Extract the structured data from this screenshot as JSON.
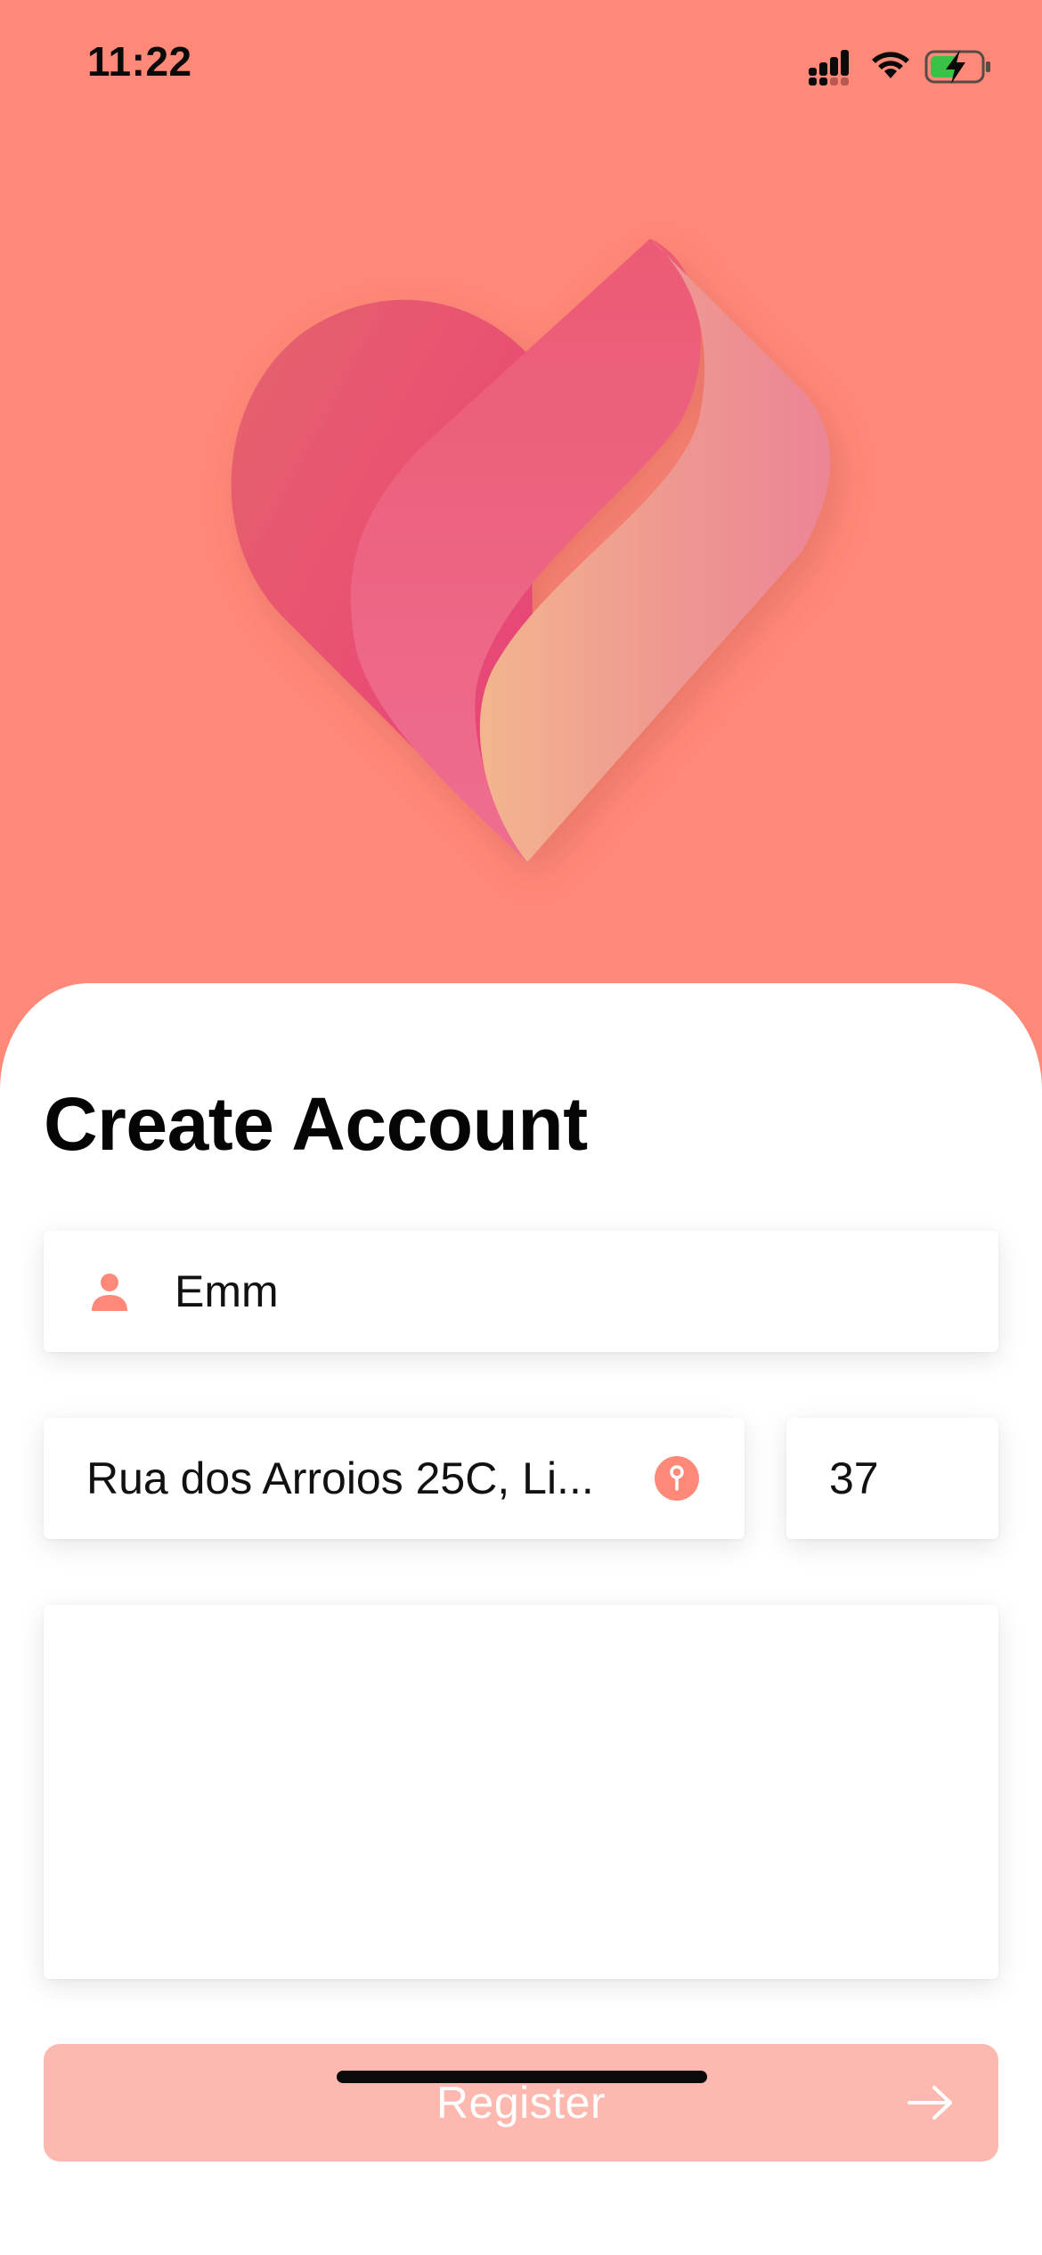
{
  "status_bar": {
    "time": "11:22",
    "icons": [
      "cellular-signal-icon",
      "wifi-icon",
      "battery-charging-icon"
    ]
  },
  "hero": {
    "icon": "heart-logo-icon"
  },
  "form": {
    "title": "Create Account",
    "name_field": {
      "icon": "person-icon",
      "value": "Emm"
    },
    "address_field": {
      "value": "Rua dos Arroios 25C, Li...",
      "icon": "map-pin-icon"
    },
    "number_field": {
      "value": "37"
    },
    "notes_field": {
      "value": ""
    },
    "register_button": {
      "label": "Register",
      "icon": "arrow-right-icon"
    }
  },
  "colors": {
    "background": "#FF8979",
    "accent": "#FF8979",
    "button_disabled": "#FDB9AF",
    "sheet": "#FFFFFF"
  }
}
